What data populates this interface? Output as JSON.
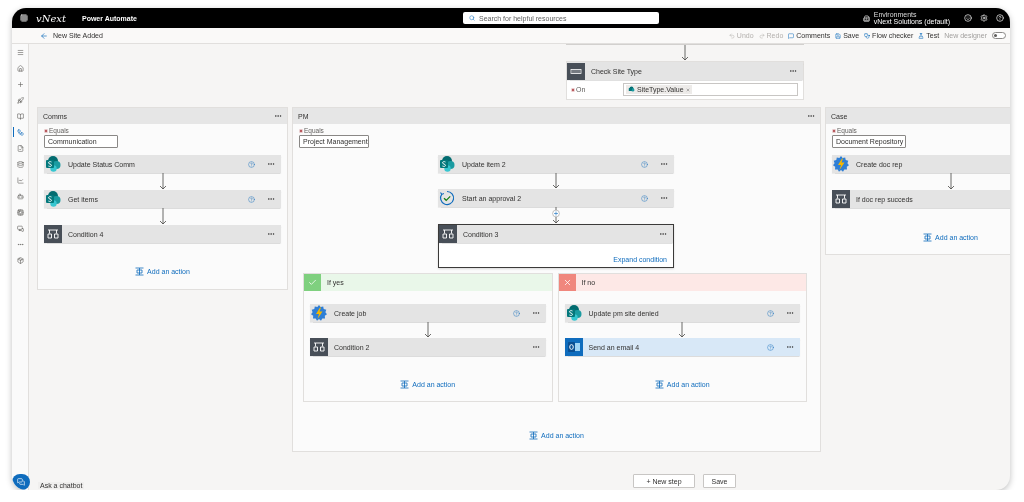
{
  "topbar": {
    "brand": "vNext",
    "app": "Power Automate",
    "search": {
      "placeholder": "Search for helpful resources"
    },
    "environment": {
      "label": "Environments",
      "value": "vNext Solutions (default)"
    }
  },
  "command_bar": {
    "title": "New Site Added",
    "buttons": [
      {
        "label": "Undo",
        "kind": "undo",
        "disabled": true
      },
      {
        "label": "Redo",
        "kind": "redo",
        "disabled": true
      },
      {
        "label": "Comments",
        "kind": "comments",
        "disabled": false
      },
      {
        "label": "Save",
        "kind": "save",
        "disabled": false
      },
      {
        "label": "Flow checker",
        "kind": "checker",
        "disabled": false
      },
      {
        "label": "Test",
        "kind": "test",
        "disabled": false
      }
    ],
    "toggle": {
      "label": "New designer",
      "on": false
    }
  },
  "rail": [
    {
      "kind": "menu",
      "selected": false
    },
    {
      "kind": "home",
      "selected": false
    },
    {
      "kind": "create",
      "selected": false
    },
    {
      "kind": "templates",
      "selected": false
    },
    {
      "kind": "learn",
      "selected": false
    },
    {
      "kind": "flows",
      "selected": true
    },
    {
      "kind": "approvals",
      "selected": false
    },
    {
      "kind": "data",
      "selected": false
    },
    {
      "kind": "monitor",
      "selected": false
    },
    {
      "kind": "ai",
      "selected": false
    },
    {
      "kind": "process",
      "selected": false
    },
    {
      "kind": "solutions",
      "selected": false
    },
    {
      "kind": "more",
      "selected": false
    },
    {
      "kind": "discover",
      "selected": false
    }
  ],
  "switch": {
    "title": "Check Site Type",
    "field_label": "On",
    "required": true,
    "token": "SiteType.Value"
  },
  "cases": [
    {
      "title": "Comms",
      "cut": false,
      "equals_label": "Equals",
      "required": true,
      "equals": "Communication",
      "actions": [
        {
          "title": "Update Status Comm",
          "kind": "sharepoint",
          "info": true,
          "highlighted": false
        },
        {
          "title": "Get items",
          "kind": "sharepoint",
          "info": true,
          "highlighted": false
        },
        {
          "title": "Condition 4",
          "kind": "condition",
          "info": false,
          "highlighted": false
        }
      ],
      "add_action": "Add an action"
    },
    {
      "title": "PM",
      "cut": false,
      "equals_label": "Equals",
      "required": true,
      "equals": "Project Management",
      "actions": [
        {
          "title": "Update item 2",
          "kind": "sharepoint",
          "info": true,
          "highlighted": false
        },
        {
          "title": "Start an approval 2",
          "kind": "approval",
          "info": true,
          "highlighted": false
        }
      ],
      "condition": {
        "title": "Condition 3",
        "selected": true,
        "link": "Expand condition",
        "branches": [
          {
            "kind": "yes",
            "title": "If yes",
            "actions": [
              {
                "title": "Create job",
                "kind": "flash",
                "info": true,
                "highlighted": false
              },
              {
                "title": "Condition 2",
                "kind": "condition",
                "info": false,
                "highlighted": false
              }
            ],
            "add_action": "Add an action"
          },
          {
            "kind": "no",
            "title": "If no",
            "actions": [
              {
                "title": "Update pm site denied",
                "kind": "sharepoint",
                "info": true,
                "highlighted": false
              },
              {
                "title": "Send an email 4",
                "kind": "outlook",
                "info": true,
                "highlighted": true
              }
            ],
            "add_action": "Add an action"
          }
        ]
      },
      "add_action": "Add an action"
    },
    {
      "title": "Case",
      "cut": true,
      "equals_label": "Equals",
      "required": true,
      "equals": "Document Repository",
      "actions": [
        {
          "title": "Create doc rep",
          "kind": "flash",
          "highlighted": false
        },
        {
          "title": "If doc rep succeds",
          "kind": "condition",
          "highlighted": false
        }
      ],
      "add_action": "Add an action"
    }
  ],
  "footer": {
    "new_step": "+ New step",
    "save": "Save"
  },
  "chatbot": {
    "label": "Ask a chatbot"
  }
}
